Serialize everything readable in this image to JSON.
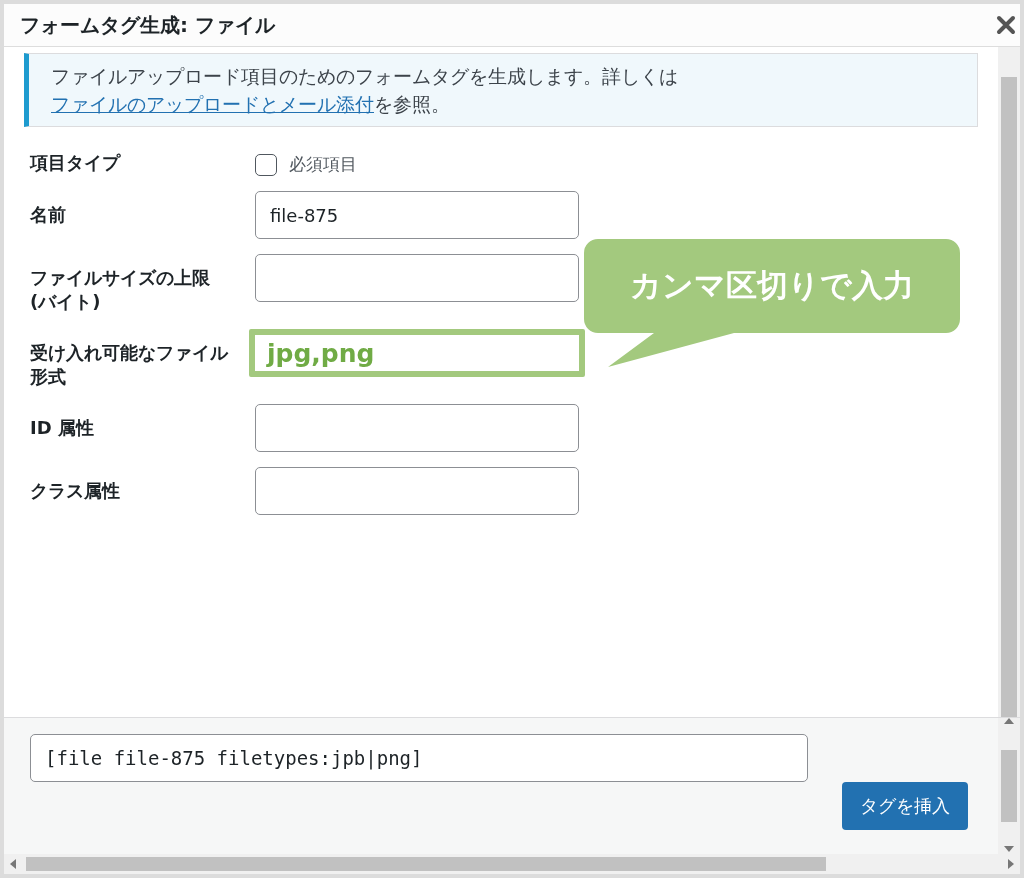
{
  "window": {
    "title": "フォームタグ生成: ファイル"
  },
  "notice": {
    "text": "ファイルアップロード項目のためのフォームタグを生成します。詳しくは",
    "link": "ファイルのアップロードとメール添付",
    "suffix": "を参照。"
  },
  "fields": [
    {
      "kind": "checkbox",
      "label": "項目タイプ",
      "option": "必須項目",
      "checked": false
    },
    {
      "kind": "text",
      "label": "名前",
      "value": "file-875",
      "highlighted": false
    },
    {
      "kind": "text",
      "label": "ファイルサイズの上限 (バイト)",
      "highlighted": false
    },
    {
      "kind": "text",
      "label": "受け入れ可能なファイル形式",
      "value": "jpg,png",
      "highlighted": true
    },
    {
      "kind": "text",
      "label": "ID 属性",
      "highlighted": false
    },
    {
      "kind": "text",
      "label": "クラス属性",
      "highlighted": false
    }
  ],
  "callout": {
    "text": "カンマ区切りで入力"
  },
  "tag_output": {
    "value": "[file file-875 filetypes:jpb|png]"
  },
  "insert_button": "タグを挿入"
}
